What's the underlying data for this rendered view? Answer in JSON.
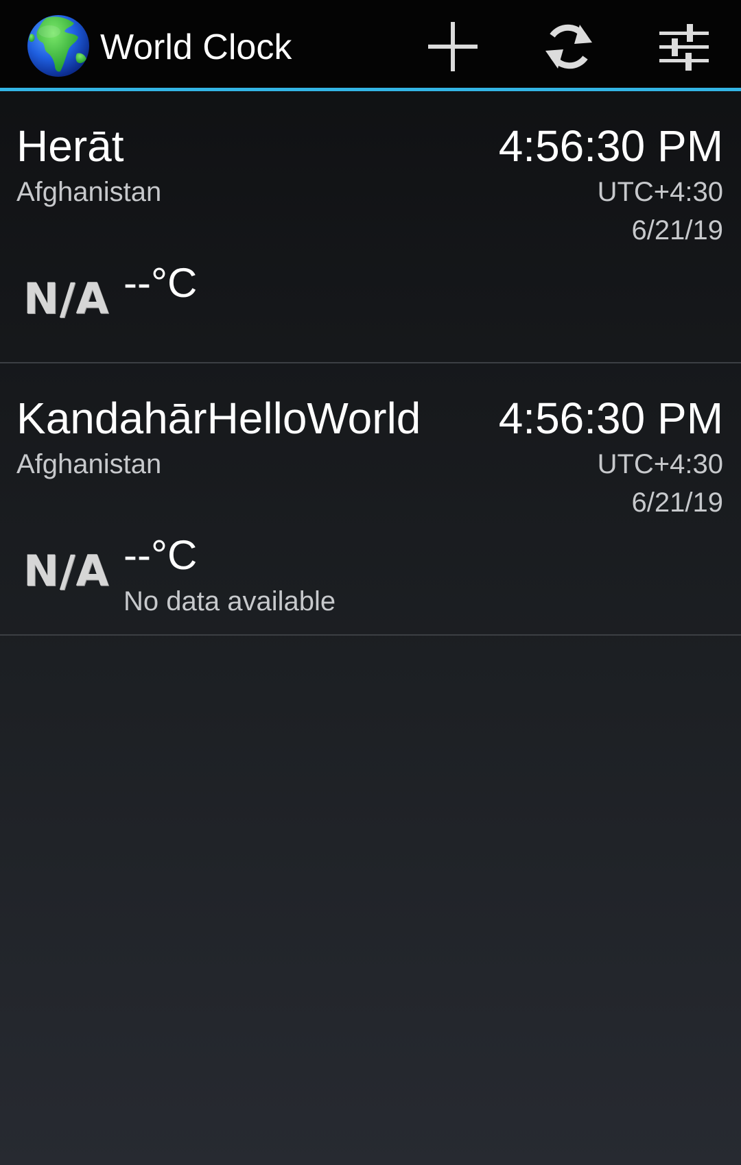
{
  "app": {
    "title": "World Clock",
    "icon": "globe-icon"
  },
  "actions": [
    {
      "name": "add",
      "icon": "plus-icon"
    },
    {
      "name": "refresh",
      "icon": "refresh-icon"
    },
    {
      "name": "settings",
      "icon": "sliders-icon"
    }
  ],
  "colors": {
    "action_bar_accent": "#33b5e5",
    "action_bar_bg": "#040404",
    "secondary_text": "#c7c9cc"
  },
  "clocks": [
    {
      "city": "Herāt",
      "country": "Afghanistan",
      "time": "4:56:30 PM",
      "utc_offset": "UTC+4:30",
      "date": "6/21/19",
      "weather_icon_text": "N/A",
      "temperature": "--°C",
      "weather_description": ""
    },
    {
      "city": "KandahārHelloWorld",
      "country": "Afghanistan",
      "time": "4:56:30 PM",
      "utc_offset": "UTC+4:30",
      "date": "6/21/19",
      "weather_icon_text": "N/A",
      "temperature": "--°C",
      "weather_description": "No data available"
    }
  ]
}
